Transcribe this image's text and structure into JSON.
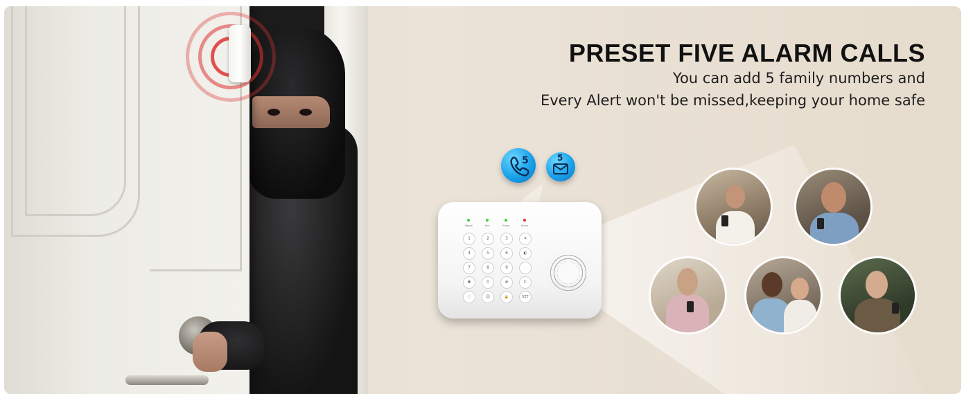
{
  "banner": {
    "headline": "PRESET FIVE ALARM CALLS",
    "subline_1": "You can add 5 family numbers and",
    "subline_2": "Every Alert won't be missed,keeping your home safe"
  },
  "hub": {
    "indicators": [
      {
        "label": "Signal",
        "color": "#3ccf3c"
      },
      {
        "label": "Arm",
        "color": "#3ccf3c"
      },
      {
        "label": "Home",
        "color": "#3ccf3c"
      },
      {
        "label": "Alarm",
        "color": "#e03030"
      }
    ],
    "keys": [
      [
        "1",
        "2",
        "3",
        "✶"
      ],
      [
        "4",
        "5",
        "6",
        "◐"
      ],
      [
        "7",
        "8",
        "9",
        "·"
      ],
      [
        "✱",
        "0",
        "#",
        "C"
      ],
      [
        "◌",
        "☺",
        "🔒",
        "SET"
      ]
    ]
  },
  "badges": {
    "call_count": "5",
    "sms_count": "5",
    "call_icon": "phone-icon",
    "sms_icon": "envelope-icon",
    "accent": "#1aa2ea"
  },
  "colors": {
    "alarm_wave": "#de3434",
    "background": "#e8dfd2"
  }
}
